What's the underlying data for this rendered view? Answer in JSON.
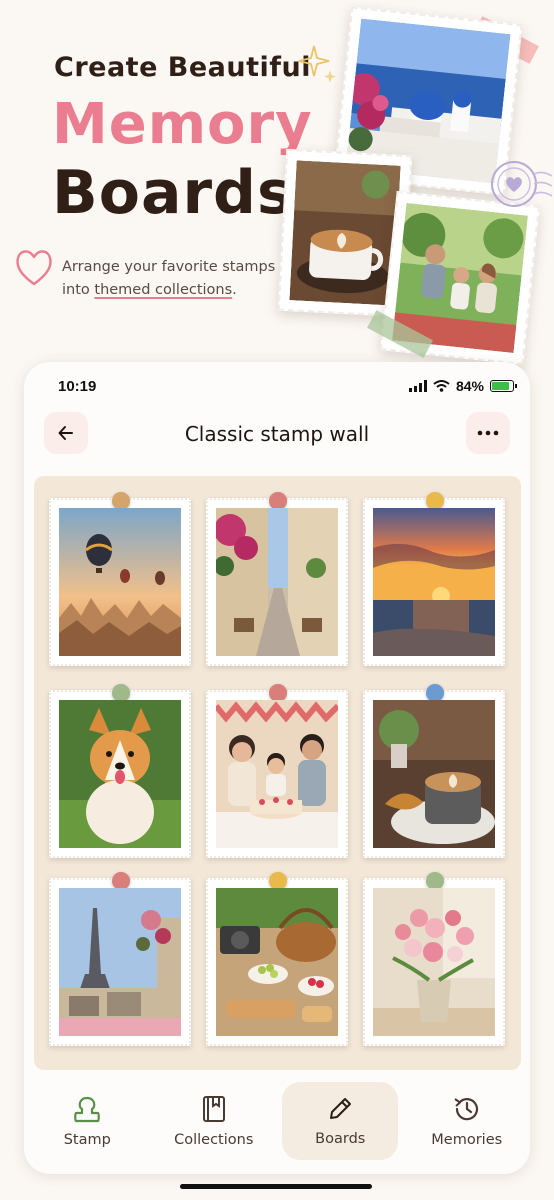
{
  "hero": {
    "line1": "Create Beautiful",
    "line2": "Memory",
    "line3": "Boards",
    "subtitle_before": "Arrange your favorite stamps into ",
    "subtitle_link": "themed collections",
    "subtitle_after": ".",
    "colors": {
      "accent": "#ea7d8f",
      "dark": "#2f1f17"
    },
    "stamps": [
      {
        "name": "santorini-stamp"
      },
      {
        "name": "latte-stamp"
      },
      {
        "name": "family-picnic-stamp"
      }
    ]
  },
  "status_bar": {
    "time": "10:19",
    "battery": "84%"
  },
  "nav": {
    "title": "Classic stamp wall",
    "back_icon": "arrow-left-icon",
    "more_icon": "more-horizontal-icon"
  },
  "board": {
    "stamps": [
      {
        "subject": "hot-air-balloons",
        "pin_color": "#d4a46a"
      },
      {
        "subject": "flower-street",
        "pin_color": "#d97e7a"
      },
      {
        "subject": "ocean-sunset",
        "pin_color": "#e9b94a"
      },
      {
        "subject": "corgi",
        "pin_color": "#9fb98a"
      },
      {
        "subject": "birthday-family",
        "pin_color": "#d97e7a"
      },
      {
        "subject": "latte-croissant",
        "pin_color": "#6b9bd1"
      },
      {
        "subject": "eiffel-tower",
        "pin_color": "#d97e7a"
      },
      {
        "subject": "picnic-basket",
        "pin_color": "#e9b94a"
      },
      {
        "subject": "pink-tulips",
        "pin_color": "#9fb98a"
      }
    ]
  },
  "tabs": [
    {
      "label": "Stamp",
      "icon": "stamp-icon",
      "active": false
    },
    {
      "label": "Collections",
      "icon": "book-icon",
      "active": false
    },
    {
      "label": "Boards",
      "icon": "pencil-icon",
      "active": true
    },
    {
      "label": "Memories",
      "icon": "history-icon",
      "active": false
    }
  ]
}
